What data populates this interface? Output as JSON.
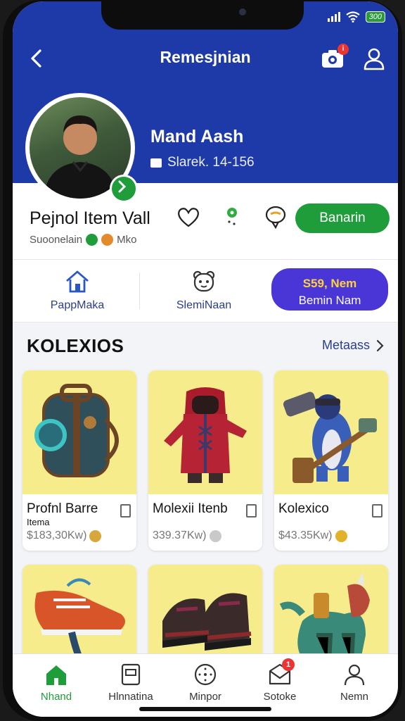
{
  "status": {
    "battery": "300"
  },
  "header": {
    "title": "Remesjnian",
    "camera_badge": "i"
  },
  "profile": {
    "name": "Mand Aash",
    "stat": "Slarek. 14-156",
    "item_title": "Pejnol Item Vall",
    "subtitle": "Suoonelain",
    "subtitle_tag": "Mko",
    "primary_action": "Banarin"
  },
  "quick_actions": [
    {
      "label": "PappMaka",
      "icon": "home-icon"
    },
    {
      "label": "SlemiNaan",
      "icon": "bear-face-icon"
    }
  ],
  "promo": {
    "line1": "S59, Nem",
    "line2": "Bemin Nam"
  },
  "section": {
    "title": "KOLEXIOS",
    "see_all": "Metaass"
  },
  "items": [
    {
      "name": "Profnl Barre",
      "name2": "Itema",
      "price": "$183,30Kw)",
      "icon": "backpack-icon"
    },
    {
      "name": "Molexii Itenb",
      "price": "339.37Kw)",
      "icon": "hoodie-icon"
    },
    {
      "name": "Kolexico",
      "price": "$43.35Kw)",
      "icon": "hammer-figure-icon"
    },
    {
      "icon": "sneaker-icon"
    },
    {
      "icon": "boots-icon"
    },
    {
      "icon": "dragon-figure-icon"
    }
  ],
  "tabs": [
    {
      "label": "Nhand",
      "icon": "home-icon"
    },
    {
      "label": "Hlnnatina",
      "icon": "page-icon"
    },
    {
      "label": "Minpor",
      "icon": "compass-icon"
    },
    {
      "label": "Sotoke",
      "icon": "mail-icon",
      "badge": "1"
    },
    {
      "label": "Nemn",
      "icon": "user-icon"
    }
  ],
  "colors": {
    "header": "#1e3aa8",
    "accent": "#1f9d3a",
    "promo": "#4a36d6",
    "card_bg": "#f6ec8c"
  }
}
